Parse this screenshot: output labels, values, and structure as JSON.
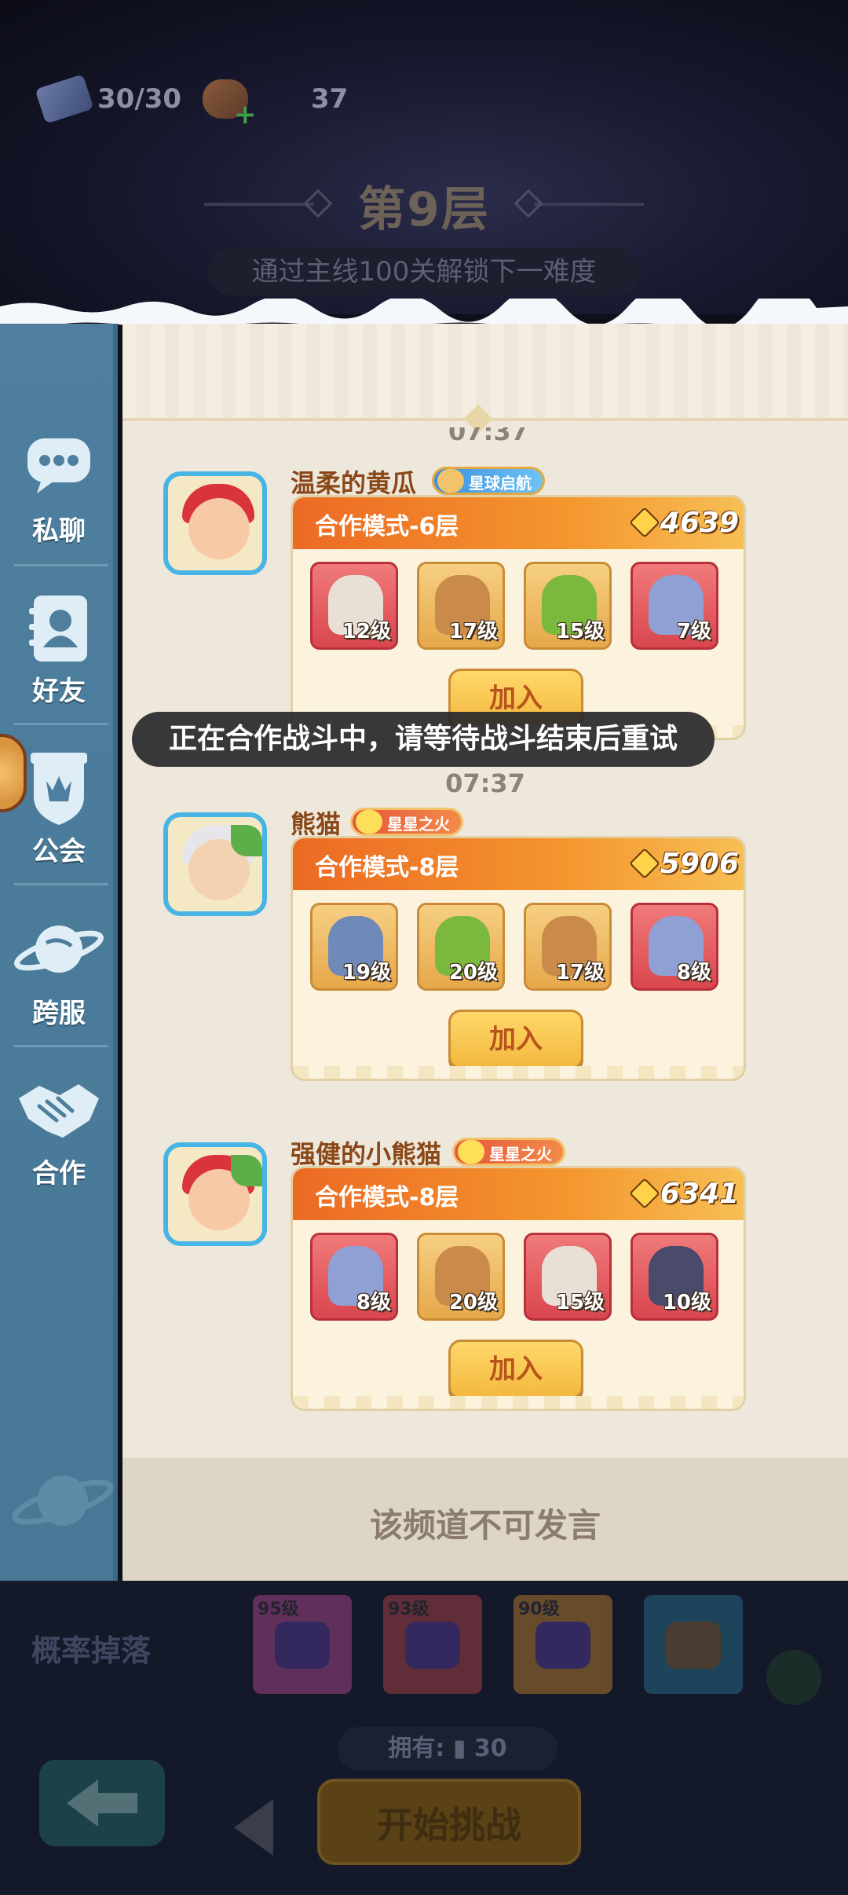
{
  "resources": {
    "tickets": "30/30",
    "food": "37"
  },
  "floor": {
    "title": "第9层",
    "unlock_hint": "通过主线100关解锁下一难度"
  },
  "sidebar": {
    "items": [
      {
        "label": "私聊",
        "icon": "chat-bubble-icon"
      },
      {
        "label": "好友",
        "icon": "friends-icon"
      },
      {
        "label": "公会",
        "icon": "guild-shield-icon"
      },
      {
        "label": "跨服",
        "icon": "planet-icon"
      },
      {
        "label": "合作",
        "icon": "handshake-icon"
      }
    ]
  },
  "chat": {
    "partial_time": "07:37",
    "messages": [
      {
        "username": "温柔的黄瓜",
        "badge": "星球启航",
        "mode": "合作模式-6层",
        "power": "4639",
        "heroes": [
          {
            "level": "12级",
            "frame": "red"
          },
          {
            "level": "17级",
            "frame": "gold"
          },
          {
            "level": "15级",
            "frame": "gold"
          },
          {
            "level": "7级",
            "frame": "red"
          }
        ],
        "join_label": "加入"
      },
      {
        "timestamp": "07:37",
        "username": "熊猫",
        "badge": "星星之火",
        "mode": "合作模式-8层",
        "power": "5906",
        "heroes": [
          {
            "level": "19级",
            "frame": "gold"
          },
          {
            "level": "20级",
            "frame": "gold"
          },
          {
            "level": "17级",
            "frame": "gold"
          },
          {
            "level": "8级",
            "frame": "red"
          }
        ],
        "join_label": "加入"
      },
      {
        "username": "强健的小熊猫",
        "badge": "星星之火",
        "mode": "合作模式-8层",
        "power": "6341",
        "heroes": [
          {
            "level": "8级",
            "frame": "red"
          },
          {
            "level": "20级",
            "frame": "gold"
          },
          {
            "level": "15级",
            "frame": "red"
          },
          {
            "level": "10级",
            "frame": "red"
          }
        ],
        "join_label": "加入"
      }
    ],
    "footer": "该频道不可发言"
  },
  "toast": "正在合作战斗中，请等待战斗结束后重试",
  "bottom": {
    "drop_label": "概率掉落",
    "drops": [
      "95级",
      "93级",
      "90级"
    ],
    "own_label": "拥有:",
    "own_value": "30",
    "start_label": "开始挑战"
  },
  "colors": {
    "sidebar": "#4e7f9e",
    "card_header": "#ec6a24",
    "join_button": "#f3b83e",
    "username": "#8a4818"
  }
}
